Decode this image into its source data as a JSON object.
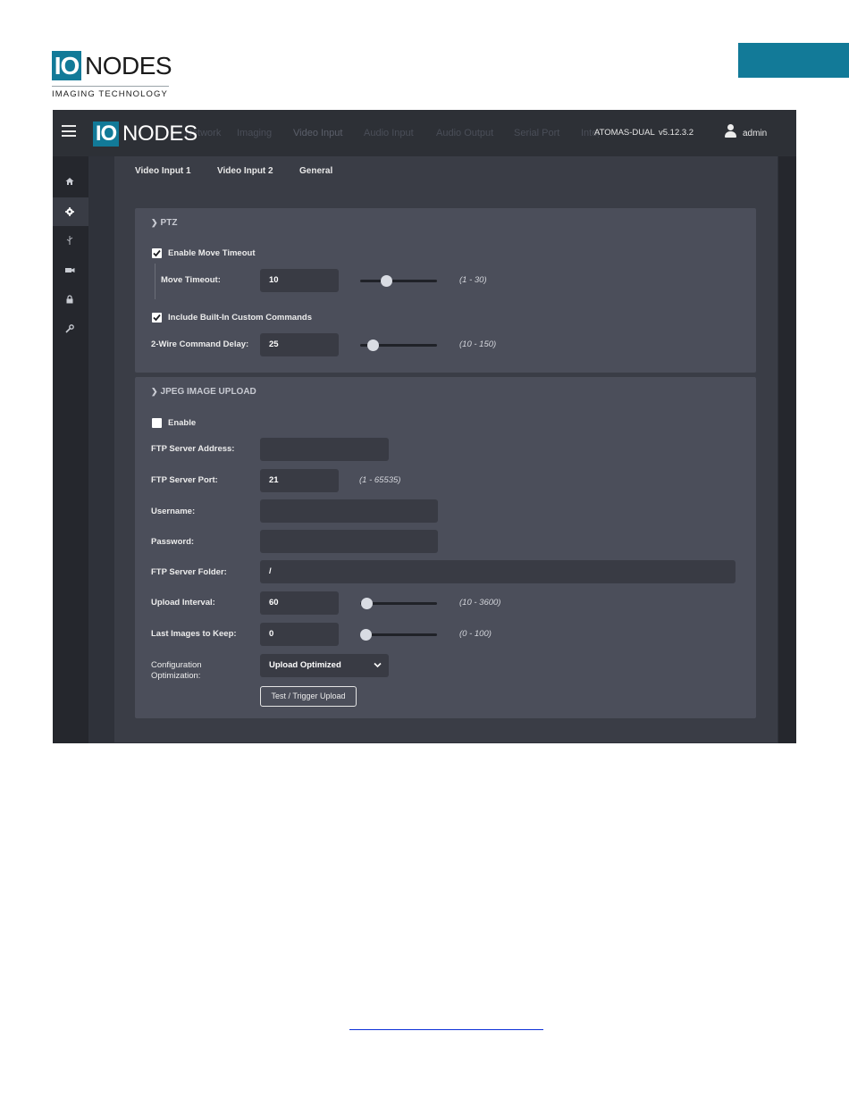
{
  "doc_header": {
    "logo_io": "IO",
    "logo_nodes": "NODES",
    "logo_tagline": "IMAGING TECHNOLOGY",
    "accent_color": "#127a98"
  },
  "topbar": {
    "logo_io": "IO",
    "logo_nodes": "NODES",
    "nav": [
      "Network",
      "Imaging",
      "Video Input",
      "Audio Input",
      "Audio Output",
      "Serial Port",
      "Integrations"
    ],
    "active_nav": "Video Input",
    "device_name": "ATOMAS-DUAL",
    "version": "v5.12.3.2",
    "username": "admin"
  },
  "sidebar": {
    "icons": [
      "home-icon",
      "gear-icon",
      "usb-icon",
      "recorder-icon",
      "lock-icon",
      "wrench-icon"
    ],
    "active": "gear-icon"
  },
  "subtabs": [
    "Video Input 1",
    "Video Input 2",
    "General"
  ],
  "ptz": {
    "title": "PTZ",
    "enable_move_timeout_label": "Enable Move Timeout",
    "enable_move_timeout_checked": true,
    "move_timeout_label": "Move Timeout:",
    "move_timeout_value": "10",
    "move_timeout_range": "(1 - 30)",
    "move_timeout_slider": {
      "min": 1,
      "max": 30,
      "value": 10
    },
    "include_builtin_label": "Include Built-In Custom Commands",
    "include_builtin_checked": true,
    "two_wire_label": "2-Wire Command Delay:",
    "two_wire_value": "25",
    "two_wire_range": "(10 - 150)",
    "two_wire_slider": {
      "min": 10,
      "max": 150,
      "value": 25
    }
  },
  "jpeg": {
    "title": "JPEG IMAGE UPLOAD",
    "enable_label": "Enable",
    "enable_checked": false,
    "ftp_address_label": "FTP Server Address:",
    "ftp_address_value": "",
    "ftp_port_label": "FTP Server Port:",
    "ftp_port_value": "21",
    "ftp_port_range": "(1 - 65535)",
    "username_label": "Username:",
    "username_value": "",
    "password_label": "Password:",
    "password_value": "",
    "folder_label": "FTP Server Folder:",
    "folder_value": "/",
    "interval_label": "Upload Interval:",
    "interval_value": "60",
    "interval_range": "(10 - 3600)",
    "interval_slider": {
      "min": 10,
      "max": 3600,
      "value": 60
    },
    "keep_label": "Last Images to Keep:",
    "keep_value": "0",
    "keep_range": "(0 - 100)",
    "keep_slider": {
      "min": 0,
      "max": 100,
      "value": 0
    },
    "config_label_line1": "Configuration",
    "config_label_line2": "Optimization:",
    "config_value": "Upload Optimized",
    "test_button": "Test / Trigger Upload"
  }
}
